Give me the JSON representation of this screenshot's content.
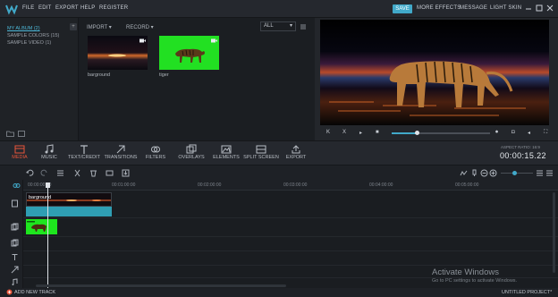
{
  "menu": {
    "items": [
      "FILE",
      "EDIT",
      "EXPORT",
      "HELP",
      "REGISTER"
    ],
    "right": {
      "save": "SAVE",
      "more_effects": "MORE EFFECTS",
      "message": "MESSAGE",
      "light_skin": "LIGHT SKIN"
    }
  },
  "albums": {
    "items": [
      {
        "label": "MY ALBUM (2)",
        "active": true
      },
      {
        "label": "SAMPLE COLORS (15)",
        "active": false
      },
      {
        "label": "SAMPLE VIDEO (1)",
        "active": false
      }
    ]
  },
  "library": {
    "import_label": "IMPORT",
    "record_label": "RECORD",
    "filter_value": "ALL",
    "media": [
      {
        "name": "barground",
        "icon": "video-camera-icon"
      },
      {
        "name": "tiger",
        "icon": "video-camera-icon"
      }
    ]
  },
  "preview": {
    "progress": 0.25
  },
  "toolbar": {
    "tools": [
      {
        "label": "MEDIA",
        "icon": "media-icon",
        "active": true
      },
      {
        "label": "MUSIC",
        "icon": "music-icon",
        "active": false
      },
      {
        "label": "TEXT/CREDIT",
        "icon": "text-icon",
        "active": false
      },
      {
        "label": "TRANSITIONS",
        "icon": "transitions-icon",
        "active": false
      },
      {
        "label": "FILTERS",
        "icon": "filters-icon",
        "active": false
      },
      {
        "label": "OVERLAYS",
        "icon": "overlays-icon",
        "active": false
      },
      {
        "label": "ELEMENTS",
        "icon": "elements-icon",
        "active": false
      },
      {
        "label": "SPLIT SCREEN",
        "icon": "split-screen-icon",
        "active": false
      },
      {
        "label": "EXPORT",
        "icon": "export-icon",
        "active": false
      }
    ],
    "aspect_ratio": "ASPECT RATIO: 16:9",
    "timecode": "00:00:15.22"
  },
  "timeline": {
    "ruler": [
      "00:00:00:00",
      "00:01:00:00",
      "00:02:00:00",
      "00:03:00:00",
      "00:04:00:00",
      "00:05:00:00"
    ],
    "clips": {
      "background_label": "barground"
    },
    "add_track": "ADD NEW TRACK",
    "project_title": "UNTITLED PROJECT*"
  },
  "watermark": {
    "title": "Activate Windows",
    "subtitle": "Go to PC settings to activate Windows."
  },
  "colors": {
    "accent": "#41a9c9",
    "active_tool": "#e8553a",
    "green_screen": "#1ee61e"
  }
}
